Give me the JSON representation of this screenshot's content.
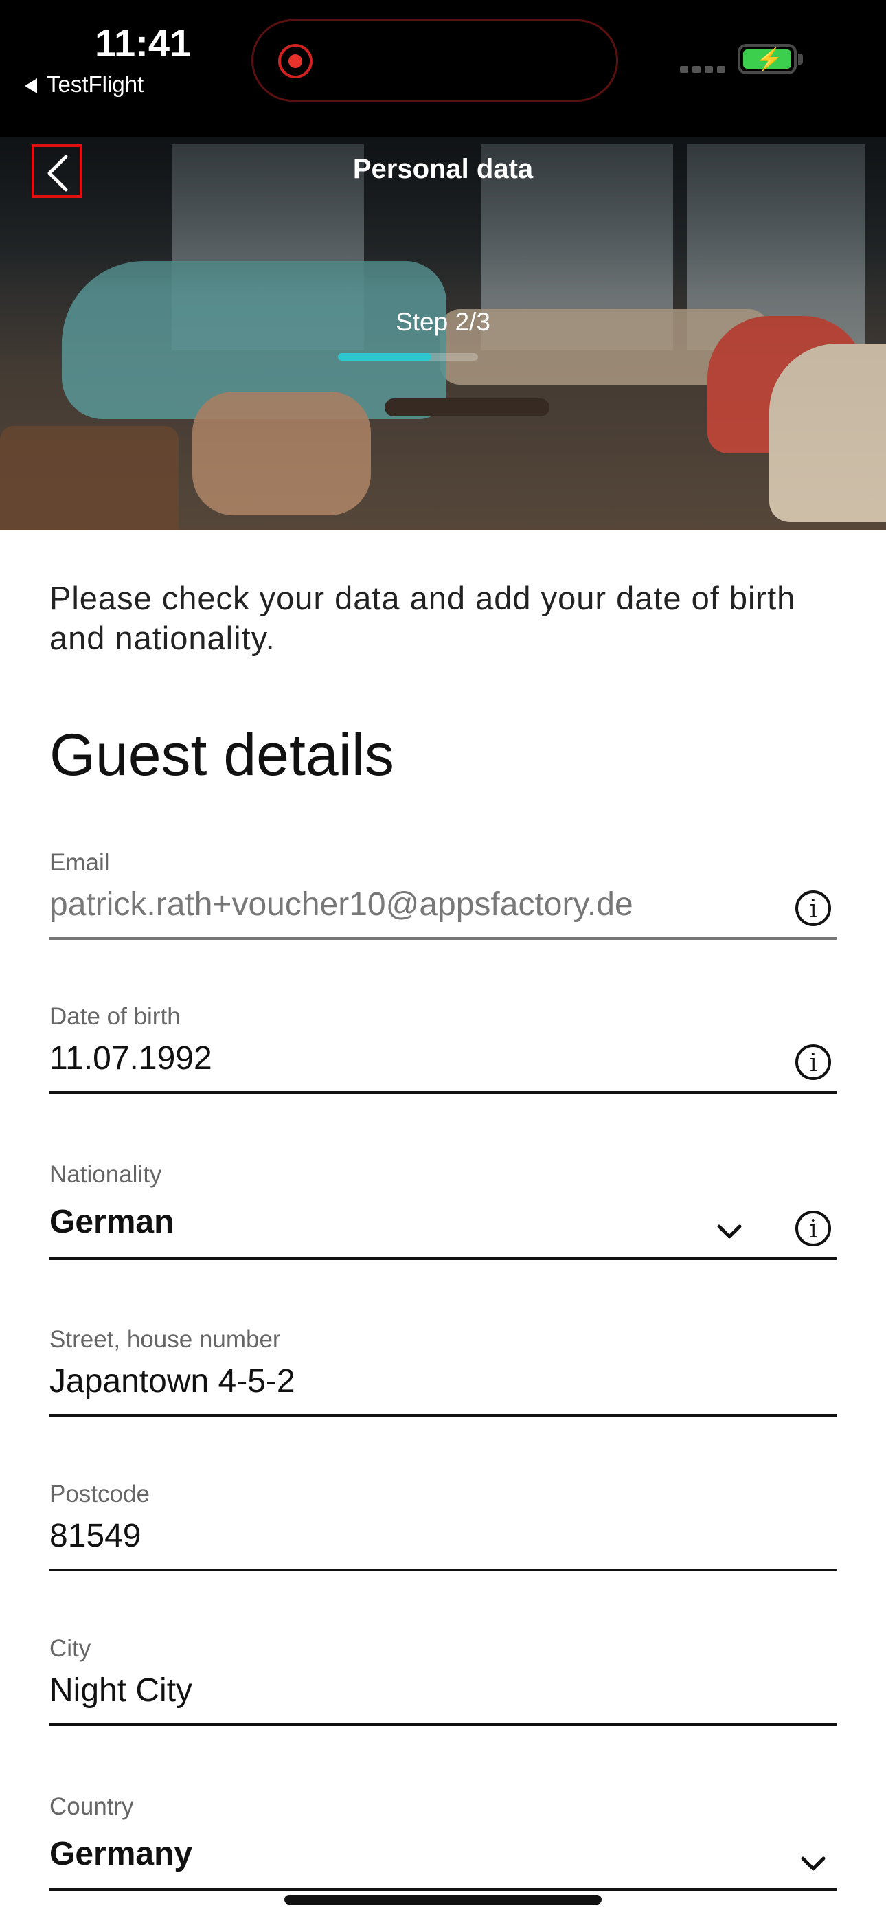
{
  "status_bar": {
    "time": "11:41",
    "back_app": "TestFlight",
    "battery_color": "#3ccf4e"
  },
  "header": {
    "title": "Personal data",
    "step": "Step 2/3",
    "progress_fraction": 0.667,
    "accent_color": "#2ec7cf"
  },
  "intro_text": "Please check your data and add your date of birth and nationality.",
  "section_title": "Guest details",
  "fields": [
    {
      "label": "Email",
      "value": "patrick.rath+voucher10@appsfactory.de"
    },
    {
      "label": "Date of birth",
      "value": "11.07.1992"
    },
    {
      "label": "Nationality",
      "value": "German"
    },
    {
      "label": "Street, house number",
      "value": "Japantown 4-5-2"
    },
    {
      "label": "Postcode",
      "value": "81549"
    },
    {
      "label": "City",
      "value": "Night City"
    },
    {
      "label": "Country",
      "value": "Germany"
    }
  ]
}
